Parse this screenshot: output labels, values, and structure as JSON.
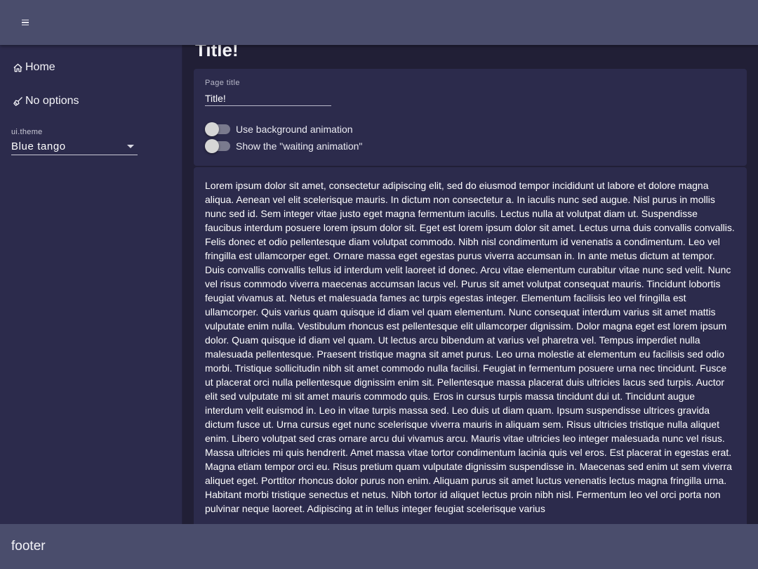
{
  "topbar": {
    "menu_icon": "hamburger-menu-icon"
  },
  "sidebar": {
    "items": [
      {
        "label": "Home",
        "icon": "home-icon"
      },
      {
        "label": "No options",
        "icon": "broom-icon"
      }
    ],
    "theme_select": {
      "label": "ui.theme",
      "value": "Blue tango"
    }
  },
  "main": {
    "title": "Title!",
    "settings": {
      "page_title_label": "Page title",
      "page_title_value": "Title!",
      "toggle_bg_label": "Use background animation",
      "toggle_bg_on": false,
      "toggle_wait_label": "Show the \"waiting animation\"",
      "toggle_wait_on": false
    },
    "body_text": "Lorem ipsum dolor sit amet, consectetur adipiscing elit, sed do eiusmod tempor incididunt ut labore et dolore magna aliqua. Aenean vel elit scelerisque mauris. In dictum non consectetur a. In iaculis nunc sed augue. Nisl purus in mollis nunc sed id. Sem integer vitae justo eget magna fermentum iaculis. Lectus nulla at volutpat diam ut. Suspendisse faucibus interdum posuere lorem ipsum dolor sit. Eget est lorem ipsum dolor sit amet. Lectus urna duis convallis convallis. Felis donec et odio pellentesque diam volutpat commodo. Nibh nisl condimentum id venenatis a condimentum. Leo vel fringilla est ullamcorper eget. Ornare massa eget egestas purus viverra accumsan in. In ante metus dictum at tempor. Duis convallis convallis tellus id interdum velit laoreet id donec. Arcu vitae elementum curabitur vitae nunc sed velit. Nunc vel risus commodo viverra maecenas accumsan lacus vel. Purus sit amet volutpat consequat mauris. Tincidunt lobortis feugiat vivamus at. Netus et malesuada fames ac turpis egestas integer. Elementum facilisis leo vel fringilla est ullamcorper. Quis varius quam quisque id diam vel quam elementum. Nunc consequat interdum varius sit amet mattis vulputate enim nulla. Vestibulum rhoncus est pellentesque elit ullamcorper dignissim. Dolor magna eget est lorem ipsum dolor. Quam quisque id diam vel quam. Ut lectus arcu bibendum at varius vel pharetra vel. Tempus imperdiet nulla malesuada pellentesque. Praesent tristique magna sit amet purus. Leo urna molestie at elementum eu facilisis sed odio morbi. Tristique sollicitudin nibh sit amet commodo nulla facilisi. Feugiat in fermentum posuere urna nec tincidunt. Fusce ut placerat orci nulla pellentesque dignissim enim sit. Pellentesque massa placerat duis ultricies lacus sed turpis. Auctor elit sed vulputate mi sit amet mauris commodo quis. Eros in cursus turpis massa tincidunt dui ut. Tincidunt augue interdum velit euismod in. Leo in vitae turpis massa sed. Leo duis ut diam quam. Ipsum suspendisse ultrices gravida dictum fusce ut. Urna cursus eget nunc scelerisque viverra mauris in aliquam sem. Risus ultricies tristique nulla aliquet enim. Libero volutpat sed cras ornare arcu dui vivamus arcu. Mauris vitae ultricies leo integer malesuada nunc vel risus. Massa ultricies mi quis hendrerit. Amet massa vitae tortor condimentum lacinia quis vel eros. Est placerat in egestas erat. Magna etiam tempor orci eu. Risus pretium quam vulputate dignissim suspendisse in. Maecenas sed enim ut sem viverra aliquet eget. Porttitor rhoncus dolor purus non enim. Aliquam purus sit amet luctus venenatis lectus magna fringilla urna. Habitant morbi tristique senectus et netus. Nibh tortor id aliquet lectus proin nibh nisl. Fermentum leo vel orci porta non pulvinar neque laoreet. Adipiscing at in tellus integer feugiat scelerisque varius"
  },
  "footer": {
    "text": "footer"
  },
  "colors": {
    "topbar_bg": "#4a4d6c",
    "sidebar_bg": "#2c2b4c",
    "main_bg": "#211f36",
    "card_bg": "#2c2b4c",
    "footer_bg": "#4a4d6c"
  }
}
